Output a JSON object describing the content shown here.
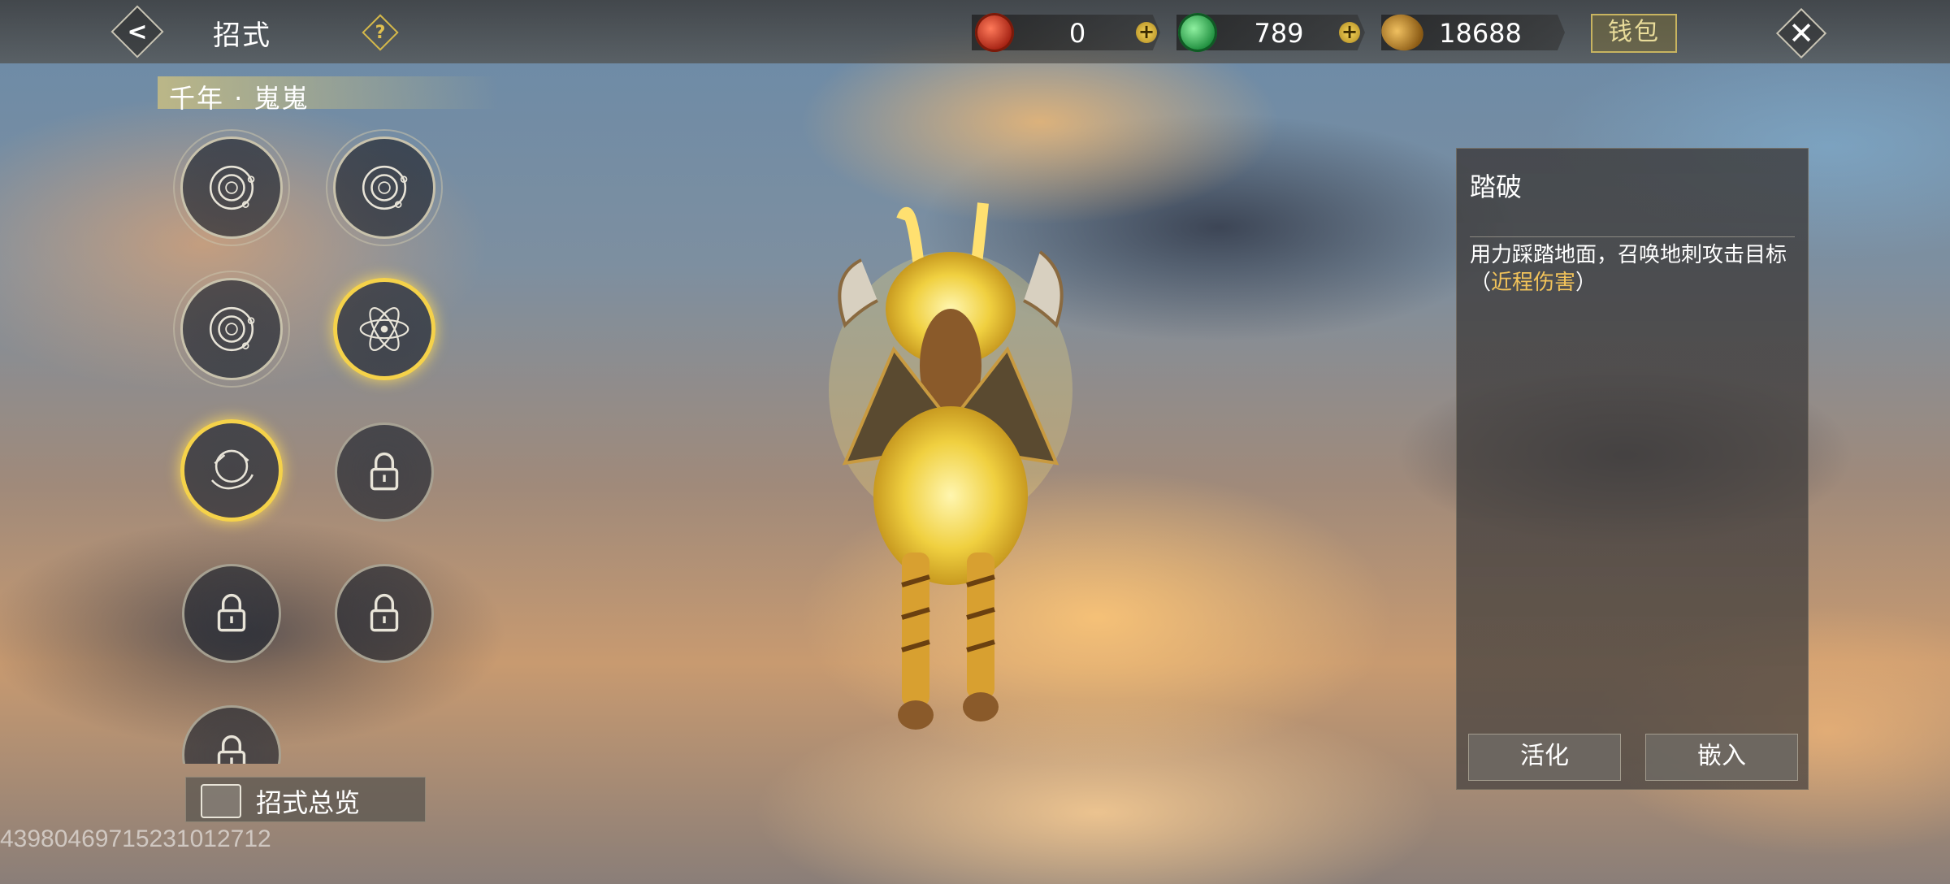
{
  "header": {
    "back_icon": "back-arrow-icon",
    "title": "招式",
    "help_label": "?",
    "currencies": [
      {
        "icon": "red-swirl-orb-icon",
        "value": "0",
        "has_plus": true,
        "color": "#c8321e"
      },
      {
        "icon": "green-jade-orb-icon",
        "value": "789",
        "has_plus": true,
        "color": "#2aa04a"
      },
      {
        "icon": "gold-coin-icon",
        "value": "18688",
        "has_plus": false,
        "color": "#c8902a"
      }
    ],
    "plus_label": "+",
    "wallet_label": "钱包",
    "close_label": "✕"
  },
  "pet": {
    "name": "千年 · 嵬嵬"
  },
  "skill_slots": [
    {
      "state": "crescent-orb",
      "selected": false
    },
    {
      "state": "crescent-orb",
      "selected": false
    },
    {
      "state": "crescent-orb",
      "selected": false
    },
    {
      "state": "atom-symbol",
      "selected": true
    },
    {
      "state": "swirl-hand",
      "selected": true
    },
    {
      "state": "locked",
      "selected": false
    },
    {
      "state": "locked",
      "selected": false
    },
    {
      "state": "locked",
      "selected": false
    },
    {
      "state": "locked",
      "selected": false
    }
  ],
  "overview": {
    "label": "招式总览"
  },
  "uid_text": "4398046971523​1012712",
  "skill_detail": {
    "name": "踏破",
    "description_main": "用力踩踏地面，召唤地刺攻击目标",
    "paren_open": "（",
    "tag": "近程伤害",
    "paren_close": "）",
    "buttons": {
      "activate": "活化",
      "embed": "嵌入"
    }
  },
  "colors": {
    "accent_gold": "#f5d24a",
    "tag_gold": "#f2c35a"
  }
}
